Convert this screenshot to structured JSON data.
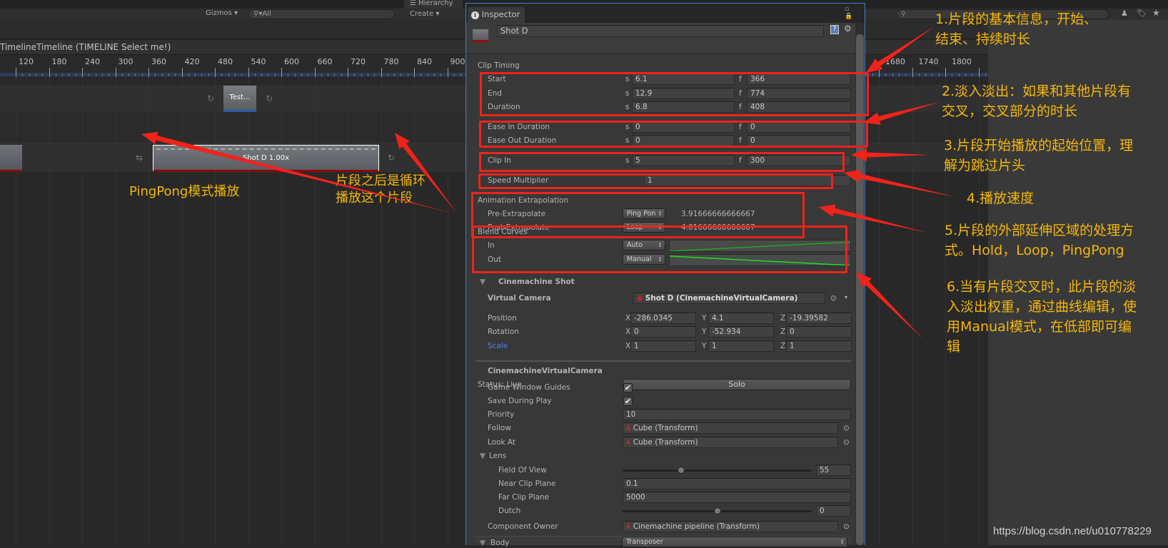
{
  "toolbar": {
    "gizmos": "Gizmos",
    "search_placeholder": "All",
    "hierarchy_tab": "Hierarchy",
    "create": "Create"
  },
  "timeline": {
    "breadcrumb": "TimelineTimeline (TIMELINE Select me!)",
    "ruler": [
      "120",
      "180",
      "240",
      "300",
      "360",
      "420",
      "480",
      "540",
      "600",
      "660",
      "720",
      "780",
      "840",
      "900"
    ],
    "ruler_right": [
      "1680",
      "1740",
      "1800"
    ],
    "clip_test": "Test...",
    "clip_shot": "Shot D 1.00x"
  },
  "inspector": {
    "tab": "Inspector",
    "object_name": "Shot D",
    "clip_timing": {
      "label": "Clip Timing",
      "rows": [
        {
          "label": "Start",
          "s": "6.1",
          "f": "366"
        },
        {
          "label": "End",
          "s": "12.9",
          "f": "774"
        },
        {
          "label": "Duration",
          "s": "6.8",
          "f": "408"
        },
        {
          "label": "Ease In Duration",
          "s": "0",
          "f": "0"
        },
        {
          "label": "Ease Out Duration",
          "s": "0",
          "f": "0"
        },
        {
          "label": "Clip In",
          "s": "5",
          "f": "300"
        }
      ],
      "s_unit": "s",
      "f_unit": "f"
    },
    "speed": {
      "label": "Speed Multiplier",
      "value": "1"
    },
    "extrapolation": {
      "label": "Animation Extrapolation",
      "rows": [
        {
          "label": "Pre-Extrapolate",
          "mode": "Ping Pon",
          "value": "3.91666666666667"
        },
        {
          "label": "Post-Extrapolate",
          "mode": "Loop",
          "value": "4.01666666666667"
        }
      ]
    },
    "blend": {
      "label": "Blend Curves",
      "rows": [
        {
          "label": "In",
          "mode": "Auto"
        },
        {
          "label": "Out",
          "mode": "Manual"
        }
      ]
    },
    "cm_shot": {
      "title": "Cinemachine Shot",
      "vcam_label": "Virtual Camera",
      "vcam_value": "Shot D (CinemachineVirtualCamera)",
      "transform": [
        {
          "label": "Position",
          "x": "-286.0345",
          "y": "4.1",
          "z": "-19.39582"
        },
        {
          "label": "Rotation",
          "x": "0",
          "y": "-52.934",
          "z": "0"
        },
        {
          "label": "Scale",
          "x": "1",
          "y": "1",
          "z": "1"
        }
      ],
      "axes": [
        "X",
        "Y",
        "Z"
      ]
    },
    "vcam": {
      "title": "CinemachineVirtualCamera",
      "status": "Status: Live",
      "solo": "Solo",
      "game_window_guides": "Game Window Guides",
      "game_window_guides_checked": true,
      "save_during_play": "Save During Play",
      "save_during_play_checked": true,
      "priority_label": "Priority",
      "priority": "10",
      "follow_label": "Follow",
      "follow": "Cube (Transform)",
      "lookat_label": "Look At",
      "lookat": "Cube (Transform)",
      "lens": "Lens",
      "fov_label": "Field Of View",
      "fov": "55",
      "fov_fraction": 0.31,
      "near_label": "Near Clip Plane",
      "near": "0.1",
      "far_label": "Far Clip Plane",
      "far": "5000",
      "dutch_label": "Dutch",
      "dutch": "0",
      "dutch_fraction": 0.5,
      "owner_label": "Component Owner",
      "owner": "Cinemachine pipeline (Transform)",
      "body_label": "Body",
      "body": "Transposer"
    }
  },
  "annotations": {
    "a1": [
      "1.片段的基本信息，开始、",
      "结束、持续时长"
    ],
    "a2": [
      "2.淡入淡出：如果和其他片段有",
      "交叉，交叉部分的时长"
    ],
    "a3": [
      "3.片段开始播放的起始位置，理",
      "解为跳过片头"
    ],
    "a4": [
      "4.播放速度"
    ],
    "a5": [
      "5.片段的外部延伸区域的处理方",
      "式。Hold，Loop，PingPong"
    ],
    "a6": [
      "6.当有片段交叉时，此片段的淡",
      "入淡出权重，通过曲线编辑，使",
      "用Manual模式，在低部即可编",
      "辑"
    ],
    "pingpong": [
      "PingPong模式播放"
    ],
    "loop": [
      "片段之后是循环",
      "播放这个片段"
    ]
  },
  "watermark": "https://blog.csdn.net/u010778229",
  "colors": {
    "annotation": "#f5b70a",
    "arrow": "#f0231b",
    "selection": "#3c7fd6",
    "curve": "#19e019"
  }
}
